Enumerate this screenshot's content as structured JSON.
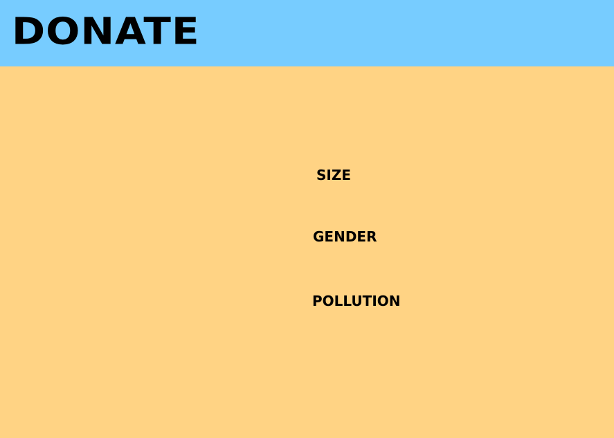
{
  "header": {
    "title": "DONATE",
    "background_color": "#77CCFF"
  },
  "main": {
    "background_color": "#FFD384",
    "options": [
      {
        "label": "SIZE"
      },
      {
        "label": "GENDER"
      },
      {
        "label": "POLLUTION"
      }
    ]
  }
}
